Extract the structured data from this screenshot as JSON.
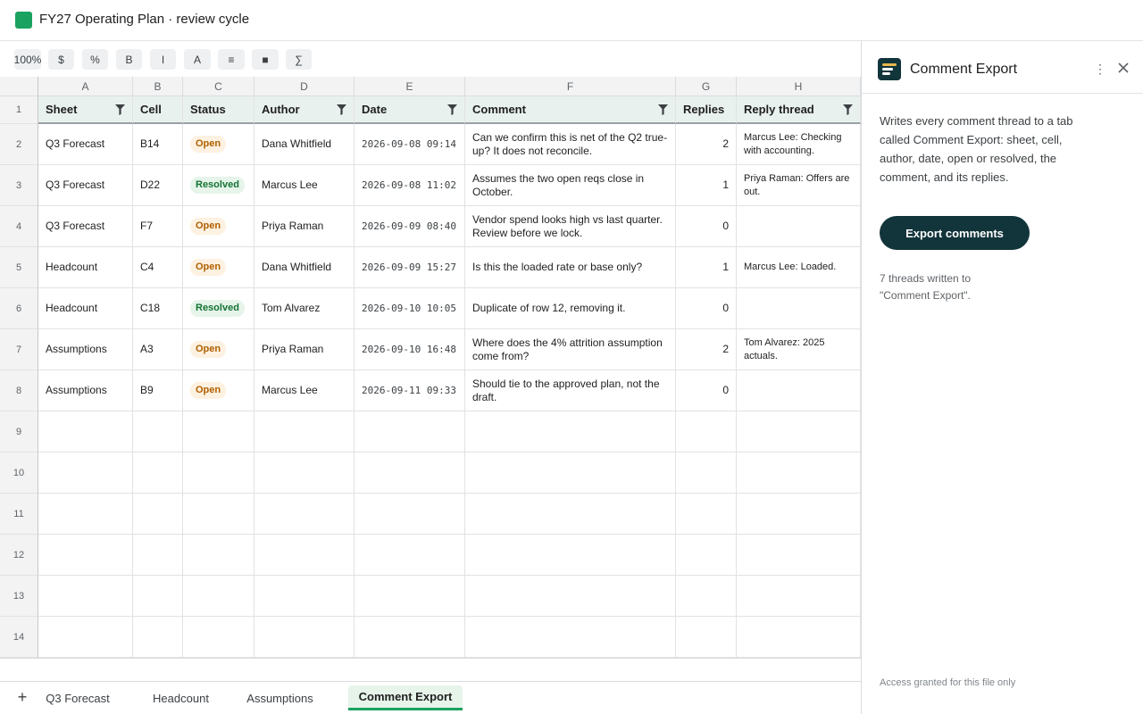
{
  "title_bar": {
    "title": "FY27 Operating Plan · review cycle"
  },
  "toolbar": {
    "zoom": "100%",
    "currency": "$",
    "percent": "%",
    "bold": "B",
    "italic": "I",
    "text_color": "A",
    "align": "≡",
    "fill": "■",
    "functions": "∑"
  },
  "grid": {
    "column_letters": [
      "A",
      "B",
      "C",
      "D",
      "E",
      "F",
      "G",
      "H"
    ],
    "header_row_number": "1",
    "headers": [
      "Sheet",
      "Cell",
      "Status",
      "Author",
      "Date",
      "Comment",
      "Replies",
      "Reply thread"
    ],
    "rows": [
      {
        "n": "2",
        "sheet": "Q3 Forecast",
        "cell": "B14",
        "status": "Open",
        "author": "Dana Whitfield",
        "date": "2026-09-08 09:14",
        "comment": "Can we confirm this is net of the Q2 true-up? It does not reconcile.",
        "replies": "2",
        "thread": "Marcus Lee: Checking with accounting."
      },
      {
        "n": "3",
        "sheet": "Q3 Forecast",
        "cell": "D22",
        "status": "Resolved",
        "author": "Marcus Lee",
        "date": "2026-09-08 11:02",
        "comment": "Assumes the two open reqs close in October.",
        "replies": "1",
        "thread": "Priya Raman: Offers are out."
      },
      {
        "n": "4",
        "sheet": "Q3 Forecast",
        "cell": "F7",
        "status": "Open",
        "author": "Priya Raman",
        "date": "2026-09-09 08:40",
        "comment": "Vendor spend looks high vs last quarter. Review before we lock.",
        "replies": "0",
        "thread": ""
      },
      {
        "n": "5",
        "sheet": "Headcount",
        "cell": "C4",
        "status": "Open",
        "author": "Dana Whitfield",
        "date": "2026-09-09 15:27",
        "comment": "Is this the loaded rate or base only?",
        "replies": "1",
        "thread": "Marcus Lee: Loaded."
      },
      {
        "n": "6",
        "sheet": "Headcount",
        "cell": "C18",
        "status": "Resolved",
        "author": "Tom Alvarez",
        "date": "2026-09-10 10:05",
        "comment": "Duplicate of row 12, removing it.",
        "replies": "0",
        "thread": ""
      },
      {
        "n": "7",
        "sheet": "Assumptions",
        "cell": "A3",
        "status": "Open",
        "author": "Priya Raman",
        "date": "2026-09-10 16:48",
        "comment": "Where does the 4% attrition assumption come from?",
        "replies": "2",
        "thread": "Tom Alvarez: 2025 actuals."
      },
      {
        "n": "8",
        "sheet": "Assumptions",
        "cell": "B9",
        "status": "Open",
        "author": "Marcus Lee",
        "date": "2026-09-11 09:33",
        "comment": "Should tie to the approved plan, not the draft.",
        "replies": "0",
        "thread": ""
      }
    ],
    "empty_row_numbers": [
      "9",
      "10",
      "11",
      "12",
      "13",
      "14"
    ]
  },
  "sheet_tabs": {
    "add_label": "+",
    "tabs": [
      {
        "label": "Q3 Forecast",
        "active": false
      },
      {
        "label": "Headcount",
        "active": false
      },
      {
        "label": "Assumptions",
        "active": false
      },
      {
        "label": "Comment Export",
        "active": true
      }
    ]
  },
  "panel": {
    "title": "Comment Export",
    "more_icon": "⋮",
    "description": "Writes every comment thread to a tab called Comment Export: sheet, cell, author, date, open or resolved, the comment, and its replies.",
    "export_button": "Export comments",
    "status": "7 threads written to \"Comment Export\".",
    "footer": "Access granted for this file only"
  },
  "colors": {
    "accent_green": "#1aa260",
    "panel_dark": "#12343b",
    "open_text": "#b06000",
    "resolved_text": "#137333"
  }
}
